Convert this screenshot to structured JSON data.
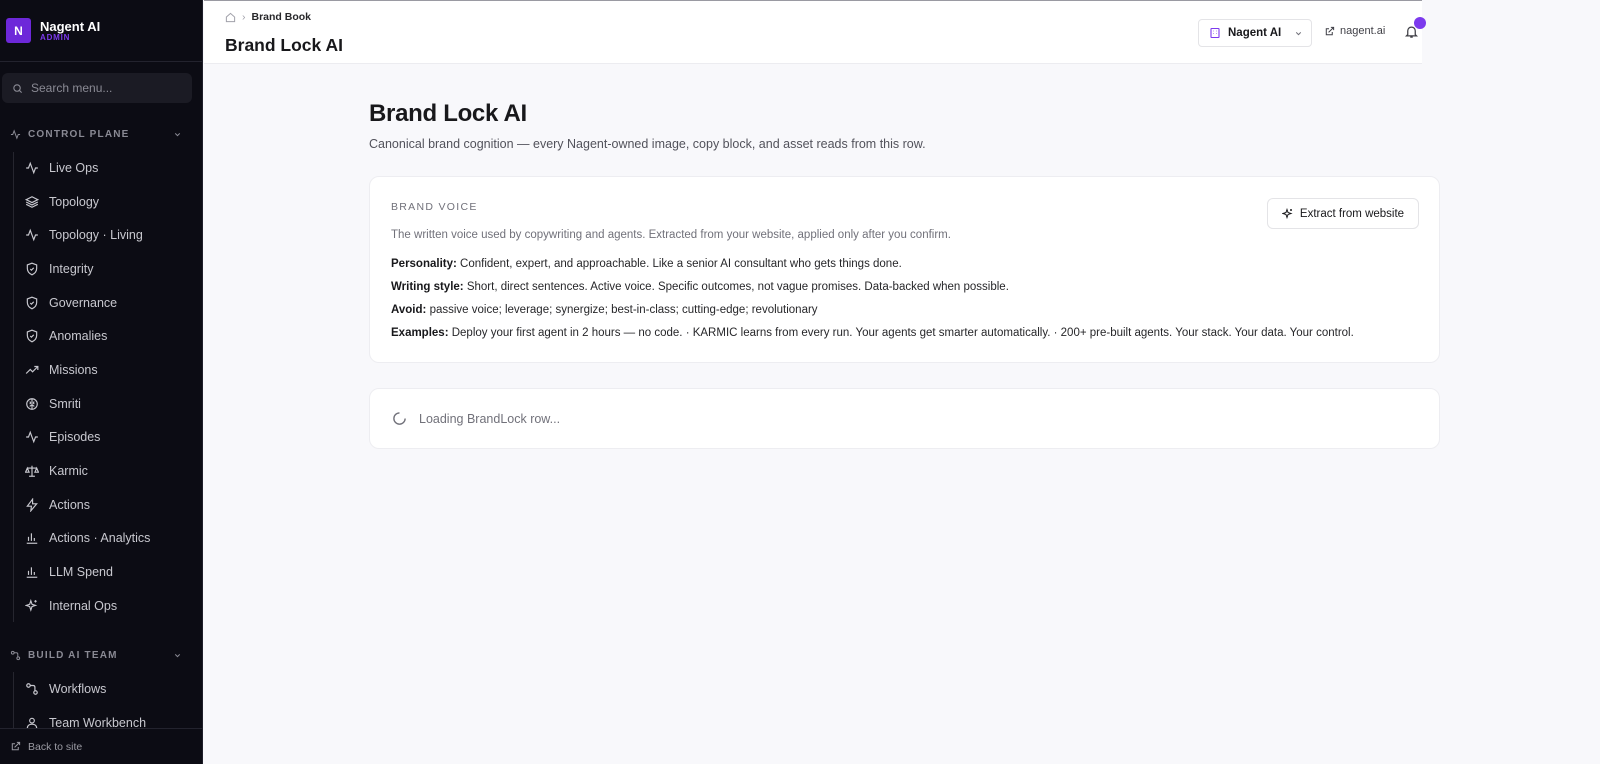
{
  "app": {
    "brand_name": "Nagent AI",
    "brand_sub": "ADMIN",
    "logo_letter": "N",
    "accent_color": "#7c3aed"
  },
  "sidebar": {
    "search_placeholder": "Search menu...",
    "sections": [
      {
        "label": "CONTROL PLANE",
        "icon": "activity-icon",
        "items": [
          {
            "label": "Live Ops",
            "icon": "activity-icon"
          },
          {
            "label": "Topology",
            "icon": "layers-icon"
          },
          {
            "label": "Topology · Living",
            "icon": "activity-icon"
          },
          {
            "label": "Integrity",
            "icon": "shield-icon"
          },
          {
            "label": "Governance",
            "icon": "shield-icon"
          },
          {
            "label": "Anomalies",
            "icon": "shield-icon"
          },
          {
            "label": "Missions",
            "icon": "trending-up-icon"
          },
          {
            "label": "Smriti",
            "icon": "brain-icon"
          },
          {
            "label": "Episodes",
            "icon": "activity-icon"
          },
          {
            "label": "Karmic",
            "icon": "scale-icon"
          },
          {
            "label": "Actions",
            "icon": "zap-icon"
          },
          {
            "label": "Actions · Analytics",
            "icon": "bar-chart-icon"
          },
          {
            "label": "LLM Spend",
            "icon": "bar-chart-icon"
          },
          {
            "label": "Internal Ops",
            "icon": "sparkles-icon"
          }
        ]
      },
      {
        "label": "BUILD AI TEAM",
        "icon": "workflow-icon",
        "items": [
          {
            "label": "Workflows",
            "icon": "workflow-icon"
          },
          {
            "label": "Team Workbench",
            "icon": "user-icon"
          }
        ]
      }
    ],
    "footer_label": "Back to site"
  },
  "topbar": {
    "breadcrumb_current": "Brand Book",
    "page_title": "Brand Lock AI",
    "org_name": "Nagent AI",
    "site_link": "nagent.ai"
  },
  "main": {
    "title": "Brand Lock AI",
    "subtitle": "Canonical brand cognition — every Nagent-owned image, copy block, and asset reads from this row.",
    "brand_voice": {
      "heading": "BRAND VOICE",
      "description": "The written voice used by copywriting and agents. Extracted from your website, applied only after you confirm.",
      "extract_button": "Extract from website",
      "fields": [
        {
          "label": "Personality:",
          "value": "Confident, expert, and approachable. Like a senior AI consultant who gets things done."
        },
        {
          "label": "Writing style:",
          "value": "Short, direct sentences. Active voice. Specific outcomes, not vague promises. Data-backed when possible."
        },
        {
          "label": "Avoid:",
          "value": "passive voice; leverage; synergize; best-in-class; cutting-edge; revolutionary"
        },
        {
          "label": "Examples:",
          "value": "Deploy your first agent in 2 hours — no code. · KARMIC learns from every run. Your agents get smarter automatically. · 200+ pre-built agents. Your stack. Your data. Your control."
        }
      ]
    },
    "loading_text": "Loading BrandLock row..."
  }
}
